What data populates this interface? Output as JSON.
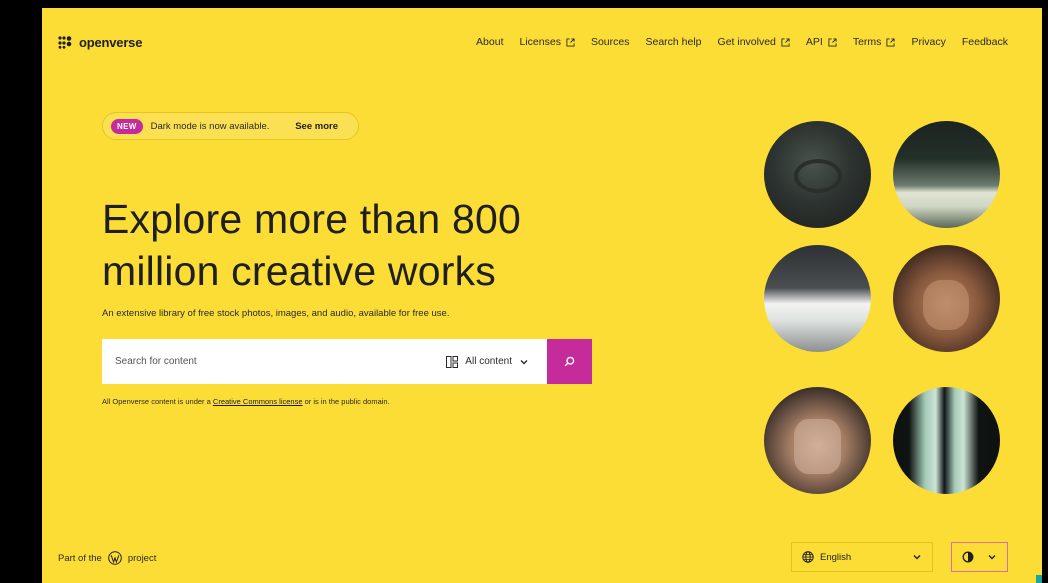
{
  "header": {
    "logo_text": "openverse",
    "nav": [
      {
        "label": "About",
        "external": false
      },
      {
        "label": "Licenses",
        "external": true
      },
      {
        "label": "Sources",
        "external": false
      },
      {
        "label": "Search help",
        "external": false
      },
      {
        "label": "Get involved",
        "external": true
      },
      {
        "label": "API",
        "external": true
      },
      {
        "label": "Terms",
        "external": true
      },
      {
        "label": "Privacy",
        "external": false
      },
      {
        "label": "Feedback",
        "external": false
      }
    ]
  },
  "banner": {
    "badge": "NEW",
    "text": "Dark mode is now available.",
    "link": "See more"
  },
  "hero": {
    "title_line1": "Explore more than 800",
    "title_line2": "million creative works",
    "subtitle": "An extensive library of free stock photos, images, and audio, available for free use."
  },
  "search": {
    "placeholder": "Search for content",
    "content_type": "All content",
    "submit_icon": "search-icon"
  },
  "legal": {
    "prefix": "All Openverse content is under a ",
    "link": "Creative Commons license",
    "suffix": " or is in the public domain."
  },
  "footer": {
    "part_of_prefix": "Part of the",
    "part_of_suffix": "project",
    "language": "English",
    "theme_icon": "contrast-icon"
  },
  "colors": {
    "background": "#fbdd35",
    "accent": "#c52b9b"
  }
}
